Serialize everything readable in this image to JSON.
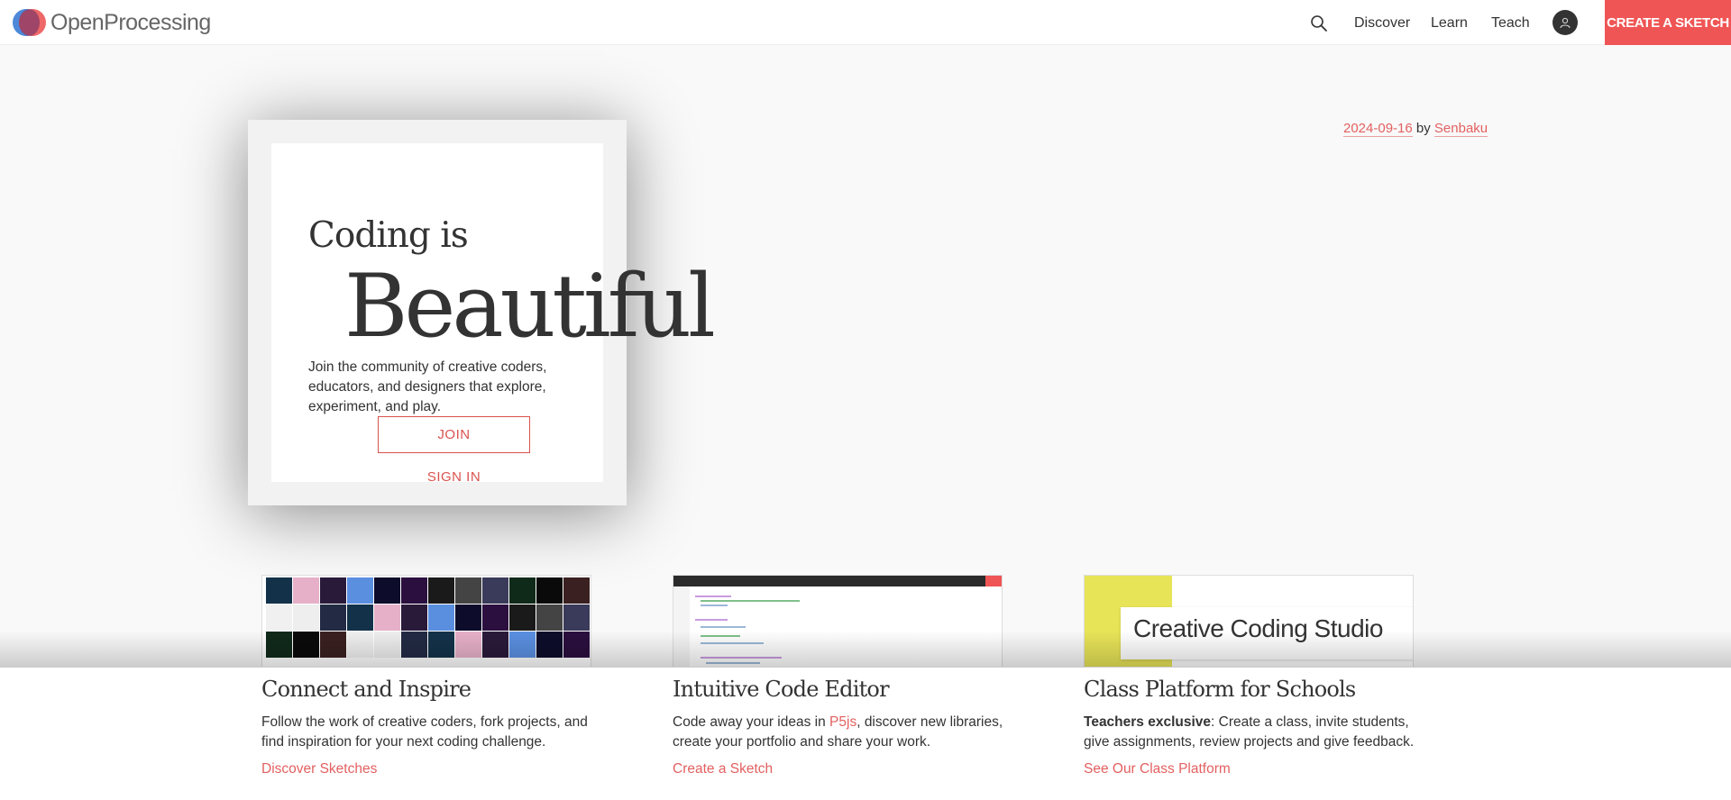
{
  "nav": {
    "logo_text": "OpenProcessing",
    "links": [
      "Discover",
      "Learn",
      "Teach"
    ],
    "cta": "CREATE A SKETCH"
  },
  "hero": {
    "line1": "Coding is",
    "line2": "Beautiful",
    "description": "Join the community of creative coders, educators, and designers that explore, experiment, and play.",
    "join": "JOIN",
    "signin": "SIGN IN"
  },
  "credit": {
    "date": "2024-09-16",
    "by": "by",
    "author": "Senbaku"
  },
  "features": [
    {
      "title": "Connect and Inspire",
      "description": "Follow the work of creative coders, fork projects, and find inspiration for your next coding challenge.",
      "link": "Discover Sketches"
    },
    {
      "title": "Intuitive Code Editor",
      "desc_pre": "Code away your ideas in ",
      "desc_link": "P5js",
      "desc_post": ", discover new libraries, create your portfolio and share your work.",
      "link": "Create a Sketch"
    },
    {
      "title": "Class Platform for Schools",
      "desc_bold": "Teachers exclusive",
      "desc_post": ": Create a class, invite students, give assignments, review projects and give feedback.",
      "link": "See Our Class Platform"
    }
  ],
  "class_preview": {
    "title": "Creative Coding Studio"
  },
  "colors": {
    "accent": "#f05555",
    "link": "#e36060"
  }
}
